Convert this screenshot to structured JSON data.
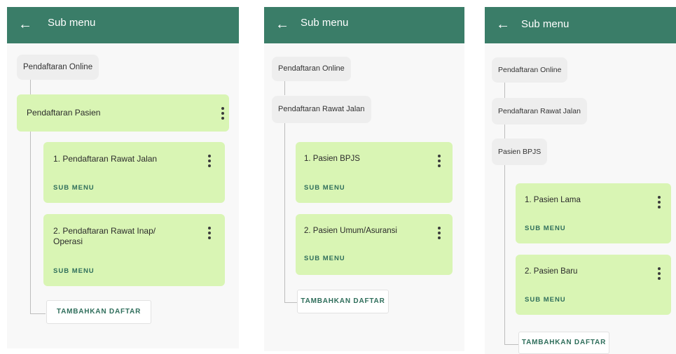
{
  "appbar": {
    "title": "Sub menu",
    "back_icon": "arrow-left-icon"
  },
  "colors": {
    "appbar": "#3a7d68",
    "card": "#d9f5b4",
    "chip": "#eeeeee",
    "accent_text": "#2f6e5b"
  },
  "screens": [
    {
      "breadcrumbs": [
        "Pendaftaran Online"
      ],
      "selected": "Pendaftaran Pasien",
      "items": [
        {
          "label": "1. Pendaftaran Rawat Jalan",
          "sub_label": "SUB MENU"
        },
        {
          "label": "2. Pendaftaran Rawat Inap/ Operasi",
          "sub_label": "SUB MENU"
        }
      ],
      "add_label": "TAMBAHKAN DAFTAR"
    },
    {
      "breadcrumbs": [
        "Pendaftaran Online",
        "Pendaftaran Rawat Jalan"
      ],
      "items": [
        {
          "label": "1. Pasien BPJS",
          "sub_label": "SUB MENU"
        },
        {
          "label": "2. Pasien Umum/Asuransi",
          "sub_label": "SUB MENU"
        }
      ],
      "add_label": "TAMBAHKAN DAFTAR"
    },
    {
      "breadcrumbs": [
        "Pendaftaran Online",
        "Pendaftaran Rawat Jalan",
        "Pasien BPJS"
      ],
      "items": [
        {
          "label": "1. Pasien Lama",
          "sub_label": "SUB MENU"
        },
        {
          "label": "2. Pasien Baru",
          "sub_label": "SUB MENU"
        }
      ],
      "add_label": "TAMBAHKAN DAFTAR"
    }
  ]
}
